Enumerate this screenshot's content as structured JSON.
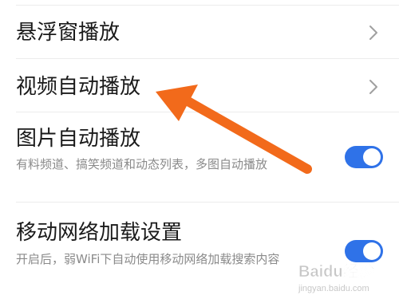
{
  "settings": {
    "floating_window": {
      "title": "悬浮窗播放",
      "icon": "chevron-right-icon"
    },
    "video_autoplay": {
      "title": "视频自动播放",
      "icon": "chevron-right-icon"
    },
    "image_autoplay": {
      "title": "图片自动播放",
      "desc": "有料频道、搞笑频道和动态列表，多图自动播放",
      "enabled": true
    },
    "mobile_network": {
      "title": "移动网络加载设置",
      "desc": "开启后，弱WiFi下自动使用移动网络加载搜索内容",
      "enabled": true
    }
  },
  "colors": {
    "toggle_on": "#2f72e8",
    "arrow": "#f26a1b"
  },
  "watermark": {
    "brand": "Baidu经验",
    "url": "jingyan.baidu.com"
  }
}
